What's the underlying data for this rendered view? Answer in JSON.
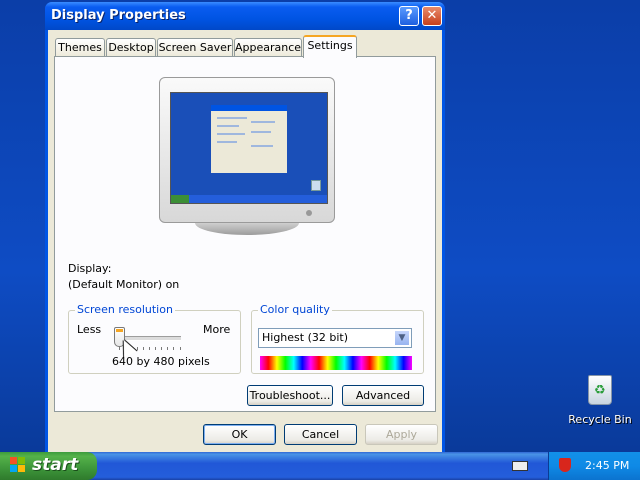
{
  "window": {
    "title": "Display Properties",
    "help_label": "?",
    "close_label": "✕"
  },
  "tabs": [
    {
      "label": "Themes",
      "active": false
    },
    {
      "label": "Desktop",
      "active": false
    },
    {
      "label": "Screen Saver",
      "active": false
    },
    {
      "label": "Appearance",
      "active": false
    },
    {
      "label": "Settings",
      "active": true
    }
  ],
  "settings": {
    "display_label": "Display:",
    "display_value": "(Default Monitor) on",
    "resolution": {
      "group_title": "Screen resolution",
      "less_label": "Less",
      "more_label": "More",
      "value_text": "640 by 480 pixels",
      "slider_fraction": 0.0
    },
    "color": {
      "group_title": "Color quality",
      "selected": "Highest (32 bit)"
    },
    "troubleshoot_label": "Troubleshoot...",
    "advanced_label": "Advanced"
  },
  "buttons": {
    "ok_label": "OK",
    "cancel_label": "Cancel",
    "apply_label": "Apply"
  },
  "taskbar": {
    "start_label": "start",
    "clock": "2:45 PM"
  },
  "desktop": {
    "recycle_label": "Recycle Bin"
  },
  "icons": {
    "close": "close-icon",
    "help": "help-icon",
    "dropdown": "chevron-down-icon",
    "windows_flag": "windows-flag-icon",
    "security": "security-shield-icon",
    "keyboard": "keyboard-icon",
    "recycle": "recycle-bin-icon"
  },
  "colors": {
    "title_bar": "#0054e3",
    "dialog_bg": "#ece9d8",
    "active_tab_accent": "#f5a623",
    "group_title": "#0046d5",
    "start_green": "#3d953a",
    "desktop_blue": "#0e4cc4"
  }
}
